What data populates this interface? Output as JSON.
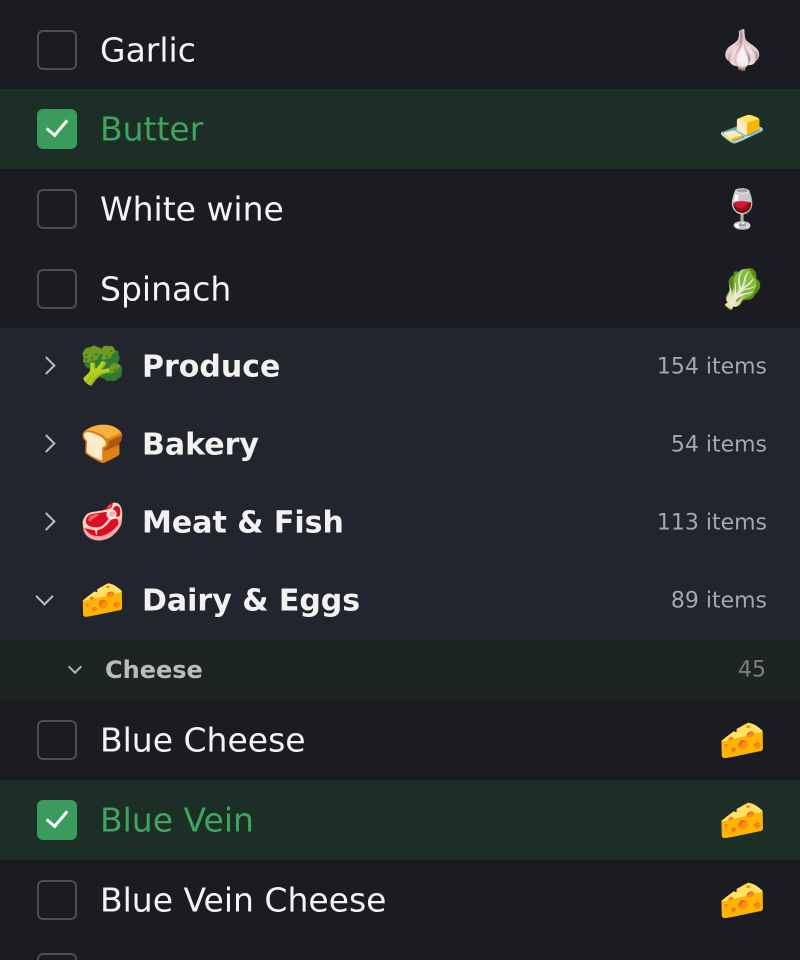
{
  "items_top": [
    {
      "label": "Garlic",
      "emoji": "🧄",
      "checked": false
    },
    {
      "label": "Butter",
      "emoji": "🧈",
      "checked": true
    },
    {
      "label": "White wine",
      "emoji": "🍷",
      "checked": false
    },
    {
      "label": "Spinach",
      "emoji": "🥬",
      "checked": false
    }
  ],
  "categories": [
    {
      "label": "Produce",
      "emoji": "🥦",
      "count": "154 items",
      "expanded": false
    },
    {
      "label": "Bakery",
      "emoji": "🍞",
      "count": "54 items",
      "expanded": false
    },
    {
      "label": "Meat & Fish",
      "emoji": "🥩",
      "count": "113 items",
      "expanded": false
    },
    {
      "label": "Dairy & Eggs",
      "emoji": "🧀",
      "count": "89 items",
      "expanded": true
    }
  ],
  "subcategory": {
    "label": "Cheese",
    "count": "45"
  },
  "items_bottom": [
    {
      "label": "Blue Cheese",
      "emoji": "🧀",
      "checked": false
    },
    {
      "label": "Blue Vein",
      "emoji": "🧀",
      "checked": true
    },
    {
      "label": "Blue Vein Cheese",
      "emoji": "🧀",
      "checked": false
    }
  ],
  "colors": {
    "background": "#1a1c22",
    "category_background": "#22252d",
    "checked_row_background": "#1c2e25",
    "accent_green": "#3ea45f"
  }
}
